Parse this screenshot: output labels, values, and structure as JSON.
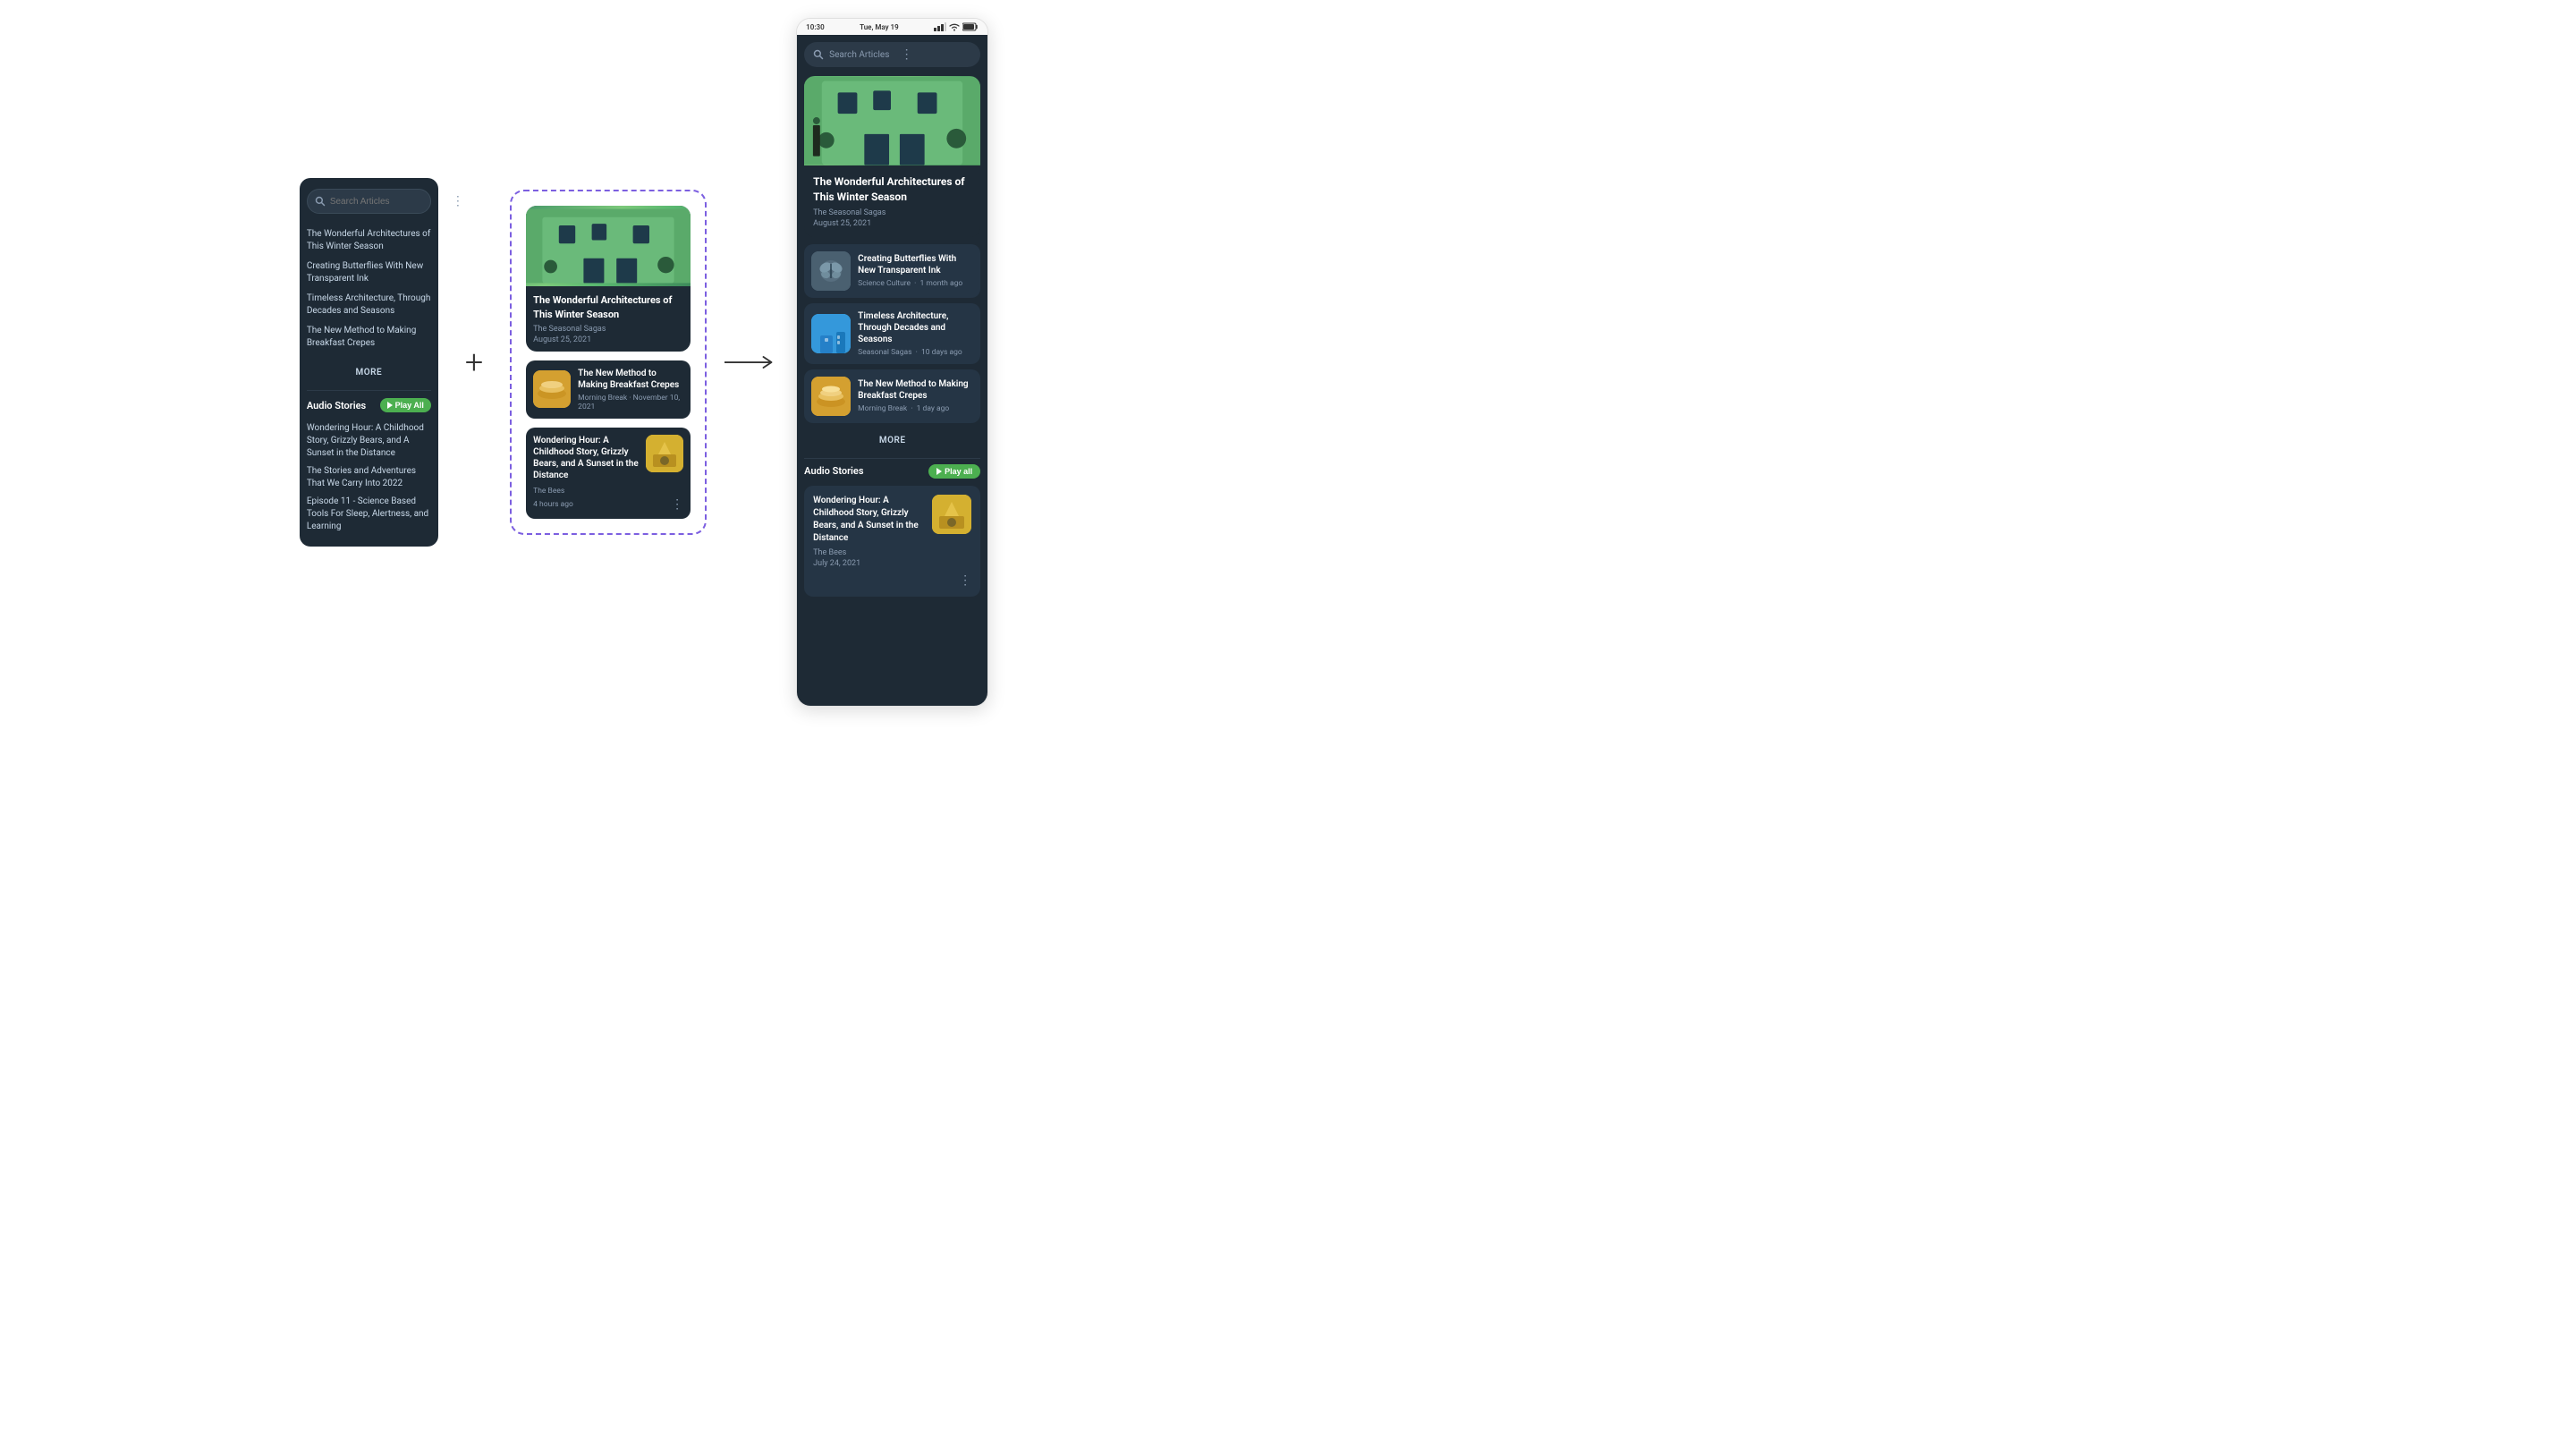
{
  "left_phone": {
    "search_placeholder": "Search Articles",
    "articles": [
      "The Wonderful Architectures of This Winter Season",
      "Creating Butterflies With New Transparent Ink",
      "Timeless Architecture, Through Decades and Seasons",
      "The New Method to Making Breakfast Crepes"
    ],
    "more_label": "MORE",
    "audio_title": "Audio Stories",
    "play_all_label": "Play All",
    "audio_items": [
      "Wondering Hour: A Childhood Story, Grizzly Bears, and A Sunset in the Distance",
      "The Stories and Adventures That We Carry Into 2022",
      "Episode 11 - Science Based Tools For Sleep, Alertness, and Learning"
    ]
  },
  "center_cards": {
    "featured": {
      "title": "The Wonderful Architectures of This Winter Season",
      "subtitle": "The Seasonal Sagas",
      "date": "August 25, 2021"
    },
    "small_cards": [
      {
        "title": "The New Method to Making Breakfast Crepes",
        "category": "Morning Break",
        "date": "November 10, 2021"
      }
    ],
    "podcast_card": {
      "title": "Wondering Hour: A Childhood Story, Grizzly Bears, and A Sunset in the Distance",
      "subtitle": "The Bees",
      "time_ago": "4 hours ago"
    }
  },
  "right_phone": {
    "status_time": "10:30",
    "status_date": "Tue, May 19",
    "search_placeholder": "Search Articles",
    "featured": {
      "title": "The Wonderful Architectures of This Winter Season",
      "subtitle": "The Seasonal Sagas",
      "date": "August 25, 2021"
    },
    "article_cards": [
      {
        "title": "Creating Butterflies With New Transparent Ink",
        "category": "Science Culture",
        "time_ago": "1 month ago",
        "thumb_type": "butterflies"
      },
      {
        "title": "Timeless Architecture, Through Decades and Seasons",
        "category": "Seasonal Sagas",
        "time_ago": "10 days ago",
        "thumb_type": "arch"
      },
      {
        "title": "The New Method to Making Breakfast Crepes",
        "category": "Morning Break",
        "time_ago": "1 day ago",
        "thumb_type": "crepes"
      }
    ],
    "more_label": "MORE",
    "audio_title": "Audio Stories",
    "play_all_label": "Play all",
    "podcast": {
      "title": "Wondering Hour: A Childhood Story, Grizzly Bears, and A Sunset in the Distance",
      "subtitle": "The Bees",
      "date": "July 24, 2021"
    }
  },
  "plus_sign": "+",
  "arrow_direction": "right"
}
